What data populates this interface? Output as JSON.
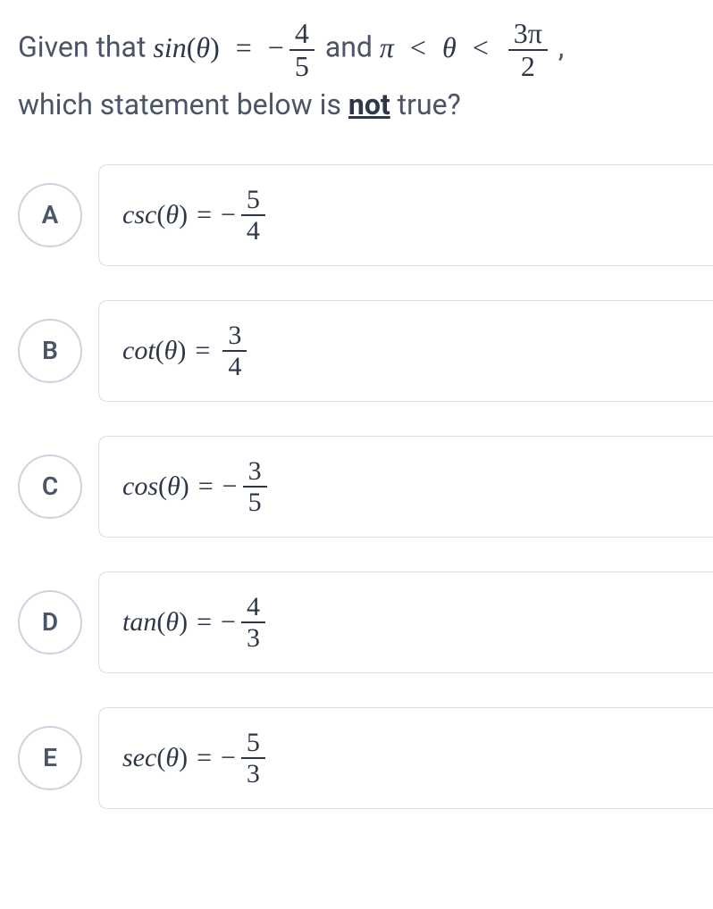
{
  "question": {
    "prefix": "Given that ",
    "sin_fn": "sin",
    "theta": "θ",
    "eq": " = ",
    "neg": "−",
    "frac1_num": "4",
    "frac1_den": "5",
    "mid": " and ",
    "pi": "π",
    "lt1": " < ",
    "lt2": " < ",
    "frac2_num": "3π",
    "frac2_den": "2",
    "comma": ",",
    "line2_pre": "which statement below is ",
    "not": "not",
    "line2_post": " true?"
  },
  "options": [
    {
      "letter": "A",
      "fn": "csc",
      "theta": "θ",
      "negative": true,
      "num": "5",
      "den": "4"
    },
    {
      "letter": "B",
      "fn": "cot",
      "theta": "θ",
      "negative": false,
      "num": "3",
      "den": "4"
    },
    {
      "letter": "C",
      "fn": "cos",
      "theta": "θ",
      "negative": true,
      "num": "3",
      "den": "5"
    },
    {
      "letter": "D",
      "fn": "tan",
      "theta": "θ",
      "negative": true,
      "num": "4",
      "den": "3"
    },
    {
      "letter": "E",
      "fn": "sec",
      "theta": "θ",
      "negative": true,
      "num": "5",
      "den": "3"
    }
  ]
}
